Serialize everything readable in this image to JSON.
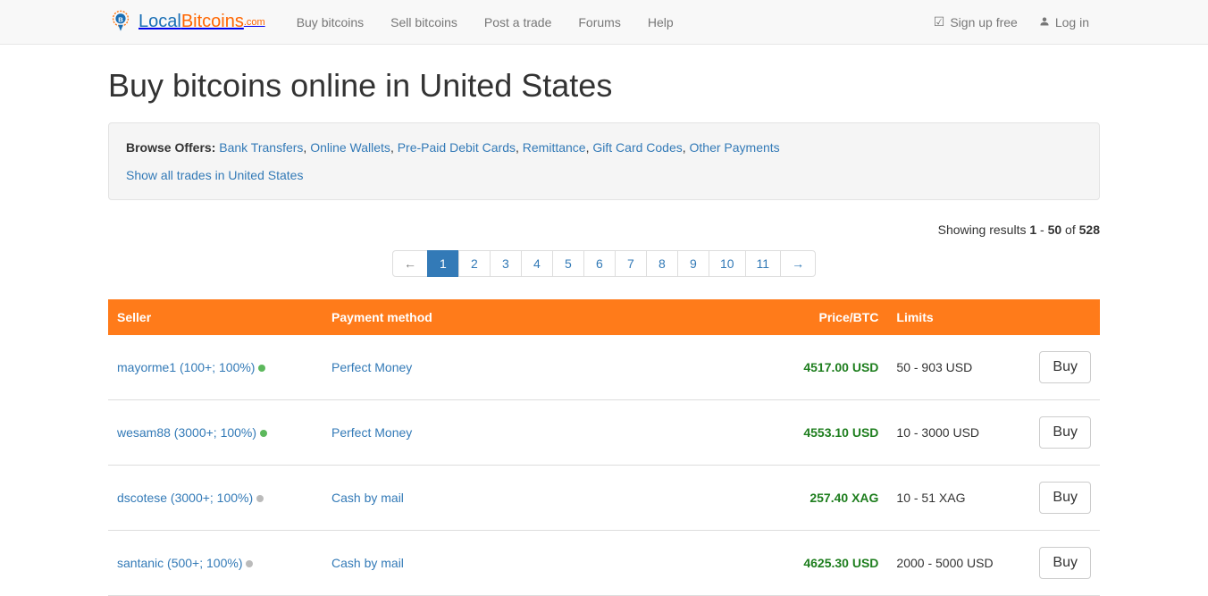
{
  "nav": {
    "brand_local": "Local",
    "brand_bitcoins": "Bitcoins",
    "brand_com": ".com",
    "links": [
      "Buy bitcoins",
      "Sell bitcoins",
      "Post a trade",
      "Forums",
      "Help"
    ],
    "signup": "Sign up free",
    "login": "Log in"
  },
  "page": {
    "title": "Buy bitcoins online in United States"
  },
  "well": {
    "browse_label": "Browse Offers:",
    "offers": [
      "Bank Transfers",
      "Online Wallets",
      "Pre-Paid Debit Cards",
      "Remittance",
      "Gift Card Codes",
      "Other Payments"
    ],
    "show_all": "Show all trades in United States"
  },
  "results": {
    "prefix": "Showing results ",
    "from": "1",
    "sep": " - ",
    "to": "50",
    "of": " of ",
    "total": "528"
  },
  "pagination": {
    "prev": "←",
    "next": "→",
    "pages": [
      "1",
      "2",
      "3",
      "4",
      "5",
      "6",
      "7",
      "8",
      "9",
      "10",
      "11"
    ],
    "active": "1"
  },
  "table": {
    "headers": {
      "seller": "Seller",
      "payment": "Payment method",
      "price": "Price/BTC",
      "limits": "Limits"
    },
    "buy_label": "Buy",
    "rows": [
      {
        "seller": "mayorme1 (100+; 100%)",
        "status": "green",
        "payment": "Perfect Money",
        "price": "4517.00 USD",
        "limits": "50 - 903 USD"
      },
      {
        "seller": "wesam88 (3000+; 100%)",
        "status": "green",
        "payment": "Perfect Money",
        "price": "4553.10 USD",
        "limits": "10 - 3000 USD"
      },
      {
        "seller": "dscotese (3000+; 100%)",
        "status": "gray",
        "payment": "Cash by mail",
        "price": "257.40 XAG",
        "limits": "10 - 51 XAG"
      },
      {
        "seller": "santanic (500+; 100%)",
        "status": "gray",
        "payment": "Cash by mail",
        "price": "4625.30 USD",
        "limits": "2000 - 5000 USD"
      }
    ]
  }
}
